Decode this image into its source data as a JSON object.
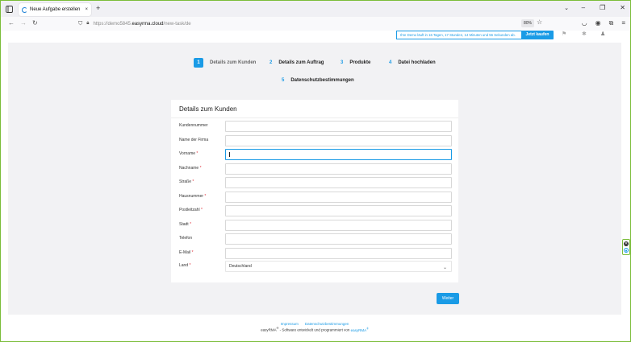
{
  "browser": {
    "tab_title": "Neue Aufgabe erstellen",
    "tab_close": "×",
    "new_tab": "+",
    "url_prefix": "https://demo5845.",
    "url_host": "easyrma.cloud",
    "url_path": "/new-task/de",
    "zoom": "80%",
    "icons": {
      "sidebar": "sidebar-icon",
      "back": "back-arrow-icon",
      "forward": "forward-arrow-icon",
      "reload": "reload-icon",
      "shield": "shield-icon",
      "lock": "lock-icon",
      "star": "bookmark-star-icon",
      "pocket": "pocket-icon",
      "account": "account-icon",
      "extensions": "extensions-icon",
      "menu": "hamburger-menu-icon",
      "minimize": "minimize-icon",
      "maximize": "maximize-icon",
      "close": "close-icon",
      "tab_list": "chevron-down-icon"
    }
  },
  "header": {
    "demo_notice": "Ihre Demo läuft in 16 Tagen, 17 Stunden, 14 Minuten und 56 Sekunden ab.",
    "buy_label": "Jetzt kaufen"
  },
  "steps": [
    {
      "num": "1",
      "label": "Details zum Kunden",
      "active": true
    },
    {
      "num": "2",
      "label": "Details zum Auftrag",
      "active": false
    },
    {
      "num": "3",
      "label": "Produkte",
      "active": false
    },
    {
      "num": "4",
      "label": "Datei hochladen",
      "active": false
    },
    {
      "num": "5",
      "label": "Datenschutzbestimmungen",
      "active": false
    }
  ],
  "form": {
    "title": "Details zum Kunden",
    "fields": [
      {
        "label": "Kundennummer",
        "required": false,
        "value": ""
      },
      {
        "label": "Name der Firma",
        "required": false,
        "value": ""
      },
      {
        "label": "Vorname",
        "required": true,
        "value": ""
      },
      {
        "label": "Nachname",
        "required": true,
        "value": ""
      },
      {
        "label": "Straße",
        "required": true,
        "value": ""
      },
      {
        "label": "Hausnummer",
        "required": true,
        "value": ""
      },
      {
        "label": "Postleitzahl",
        "required": true,
        "value": ""
      },
      {
        "label": "Stadt",
        "required": true,
        "value": ""
      },
      {
        "label": "Telefon",
        "required": false,
        "value": ""
      },
      {
        "label": "E-Mail",
        "required": true,
        "value": ""
      },
      {
        "label": "Land",
        "required": true,
        "value": "Deutschland"
      }
    ],
    "required_mark": "*",
    "submit_label": "Weiter"
  },
  "footer": {
    "link_imprint": "Impressum",
    "link_privacy": "Datenschutzbestimmungen",
    "copy_prefix": "easyRMA",
    "copy_reg": "®",
    "copy_middle": " - Software entwickelt und programmiert von ",
    "copy_brand": "easyRMA",
    "copy_brand_reg": "®"
  },
  "colors": {
    "accent": "#1a9be6",
    "required": "#e0303a",
    "frame": "#7bbd3a"
  }
}
